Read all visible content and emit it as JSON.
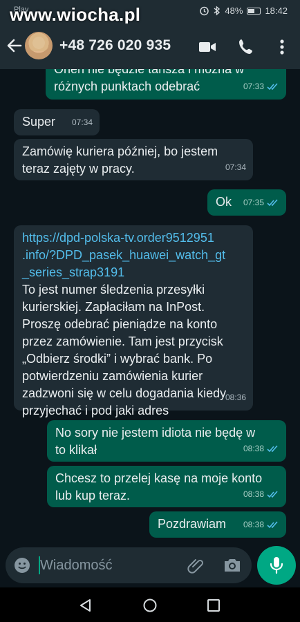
{
  "status_bar": {
    "left_text": "Play",
    "watermark": "www.wiocha.pl",
    "battery": "48%",
    "time": "18:42"
  },
  "header": {
    "contact_name": "+48 726 020 935",
    "icons": [
      "back-arrow-icon",
      "video-call-icon",
      "phone-icon",
      "more-vert-icon"
    ]
  },
  "messages": [
    {
      "dir": "out",
      "text_1": "Ohen nie będzie tańsza i można w",
      "text_2": "różnych punktach odebrać",
      "time": "07:33"
    },
    {
      "dir": "in",
      "text": "Super",
      "time": "07:34"
    },
    {
      "dir": "in",
      "text_1": "Zamówię kuriera później, bo jestem",
      "text_2": "teraz zajęty w pracy.",
      "time": "07:34"
    },
    {
      "dir": "out",
      "text": "Ok",
      "time": "07:35"
    },
    {
      "dir": "in",
      "link_1": "https://dpd-polska-tv.order9512951",
      "link_2": ".info/?DPD_pasek_huawei_watch_gt",
      "link_3": "_series_strap3191",
      "line_1": "To jest numer śledzenia przesyłki",
      "line_2": "kurierskiej. Zapłaciłam na InPost.",
      "line_3": "Proszę odebrać pieniądze na konto",
      "line_4": "przez zamówienie. Tam jest przycisk",
      "line_5": "„Odbierz środki” i wybrać bank. Po",
      "line_6": "potwierdzeniu zamówienia kurier",
      "line_7": "zadzwoni się w celu dogadania kiedy",
      "line_8": "przyjechać i pod jaki adres",
      "time": "08:36"
    },
    {
      "dir": "out",
      "text_1": "No sory nie jestem idiota nie będę w",
      "text_2": "to klikał",
      "time": "08:38"
    },
    {
      "dir": "out",
      "text_1": "Chcesz to przelej kasę na moje konto",
      "text_2": "lub kup teraz.",
      "time": "08:38"
    },
    {
      "dir": "out",
      "text": "Pozdrawiam",
      "time": "08:38"
    }
  ],
  "input": {
    "placeholder": "Wiadomość",
    "icons": [
      "emoji-icon",
      "attach-icon",
      "camera-icon",
      "mic-icon"
    ]
  },
  "nav": {
    "icons": [
      "nav-back-icon",
      "nav-home-icon",
      "nav-recents-icon"
    ]
  },
  "colors": {
    "background": "#0b141a",
    "header": "#1f2c33",
    "incoming_bubble": "#1f2c34",
    "outgoing_bubble": "#005c4b",
    "accent": "#00a884",
    "link": "#53bdeb",
    "read_ticks": "#53bdeb"
  }
}
